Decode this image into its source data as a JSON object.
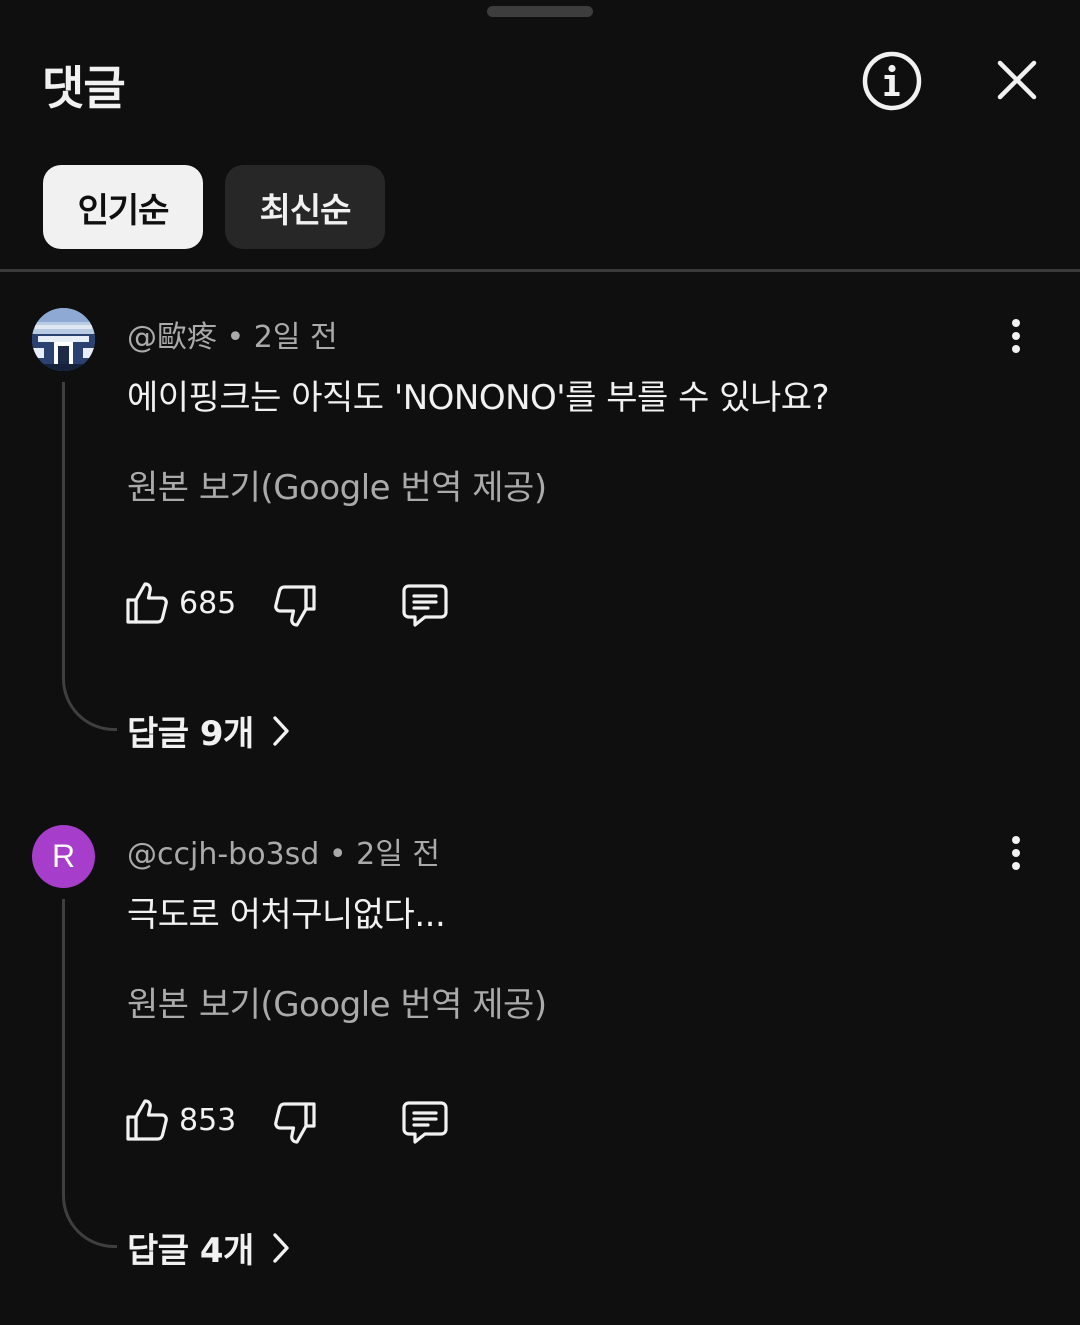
{
  "header": {
    "title": "댓글"
  },
  "sort_tabs": [
    {
      "label": "인기순",
      "selected": true
    },
    {
      "label": "최신순",
      "selected": false
    }
  ],
  "comments": [
    {
      "author": "@歐疼",
      "time": "2일 전",
      "text": "에이핑크는 아직도 'NONONO'를 부를 수 있나요?",
      "translate_label": "원본 보기(Google 번역 제공)",
      "likes": "685",
      "replies_label": "답글 9개",
      "avatar": {
        "type": "image",
        "icon": "photo-avatar"
      }
    },
    {
      "author": "@ccjh-bo3sd",
      "time": "2일 전",
      "text": "극도로 어처구니없다...",
      "translate_label": "원본 보기(Google 번역 제공)",
      "likes": "853",
      "replies_label": "답글 4개",
      "avatar": {
        "type": "letter",
        "letter": "R",
        "color": "#a73ecb"
      }
    }
  ],
  "colors": {
    "background": "#0f0f0f",
    "chip_active": "#f1f1f1",
    "chip_inactive": "#272727",
    "secondary_text": "#aaaaaa"
  }
}
